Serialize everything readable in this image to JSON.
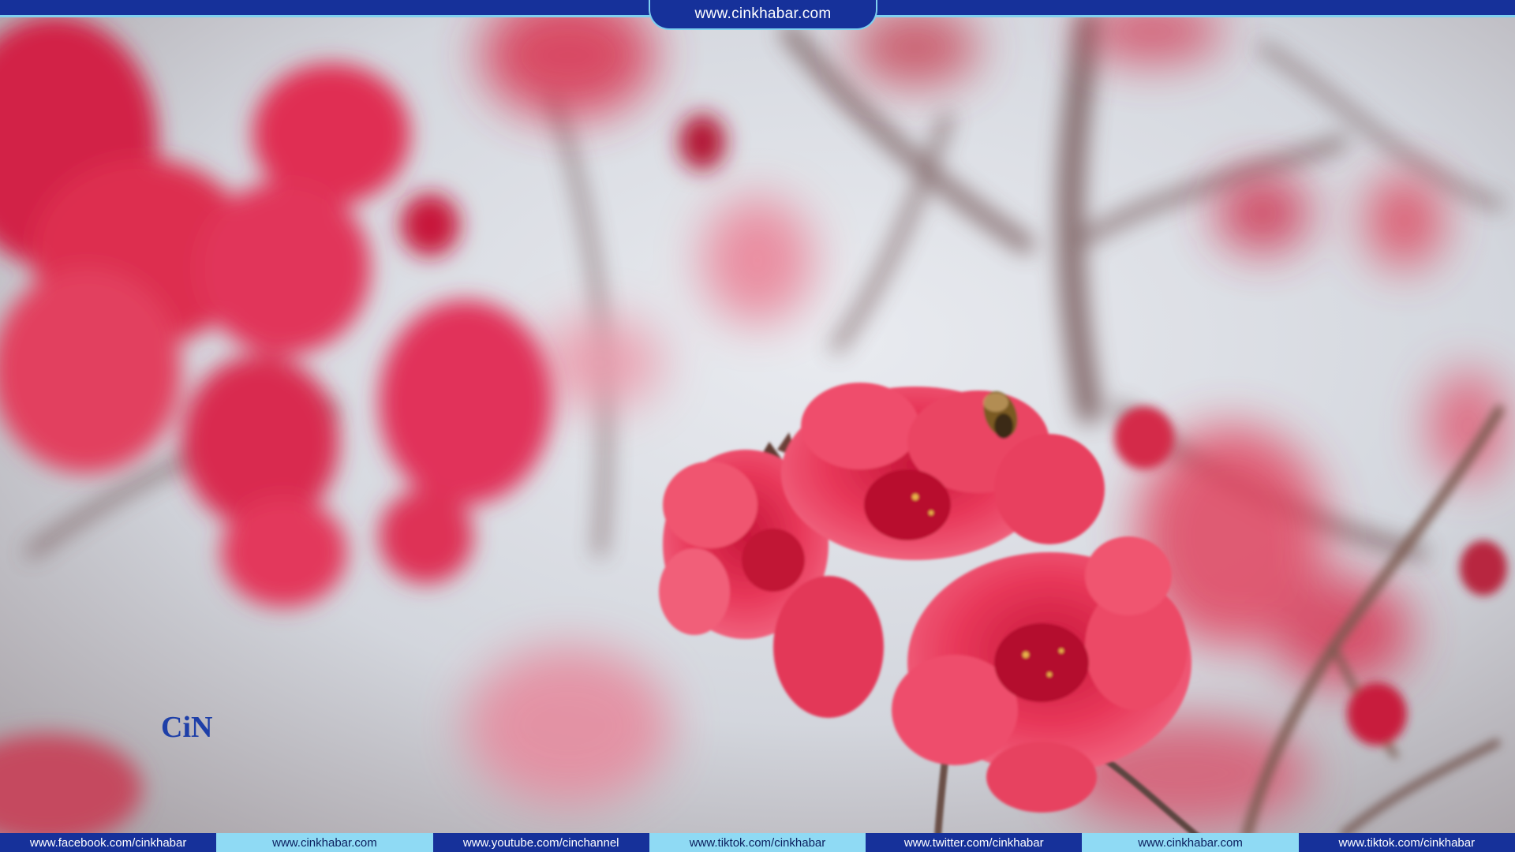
{
  "header": {
    "site_url": "www.cinkhabar.com"
  },
  "watermark": {
    "logo_text": "CiN"
  },
  "footer": {
    "links": [
      "www.facebook.com/cinkhabar",
      "www.cinkhabar.com",
      "www.youtube.com/cinchannel",
      "www.tiktok.com/cinkhabar",
      "www.twitter.com/cinkhabar",
      "www.cinkhabar.com",
      "www.tiktok.com/cinkhabar"
    ]
  },
  "colors": {
    "bar_dark": "#16319a",
    "bar_light": "#8fdaf4",
    "blossom": "#e0324f"
  }
}
